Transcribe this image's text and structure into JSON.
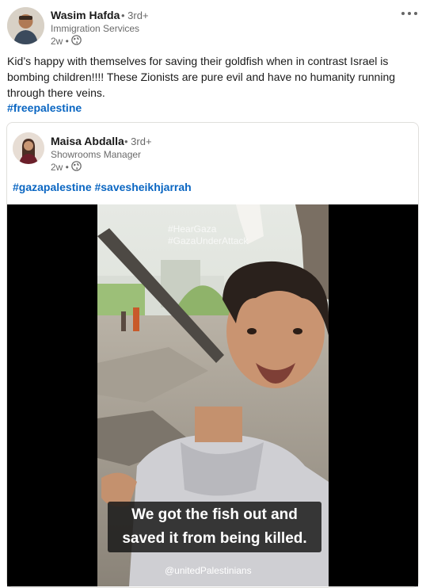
{
  "post": {
    "author": {
      "name": "Wasim Hafda",
      "degree": "• 3rd+",
      "headline": "Immigration Services",
      "time": "2w •"
    },
    "more_icon": "ellipsis-icon",
    "text": "Kid’s happy with themselves for saving their goldfish when in contrast Israel is bombing children!!!! These Zionists are pure evil and have no humanity running through there veins.",
    "hashtag": "#freepalestine"
  },
  "shared": {
    "author": {
      "name": "Maisa Abdalla",
      "degree": "• 3rd+",
      "headline": "Showrooms Manager",
      "time": "2w •"
    },
    "hashtags": "#gazapalestine #savesheikhjarrah",
    "video": {
      "overlay_line1": "#HearGaza",
      "overlay_line2": "#GazaUnderAttack",
      "caption_line1": "We got the fish out and",
      "caption_line2": "saved it from being killed.",
      "watermark": "@unitedPalestinians"
    }
  },
  "colors": {
    "link": "#0a66c2",
    "muted": "#666666",
    "border": "#e0dfdc"
  }
}
